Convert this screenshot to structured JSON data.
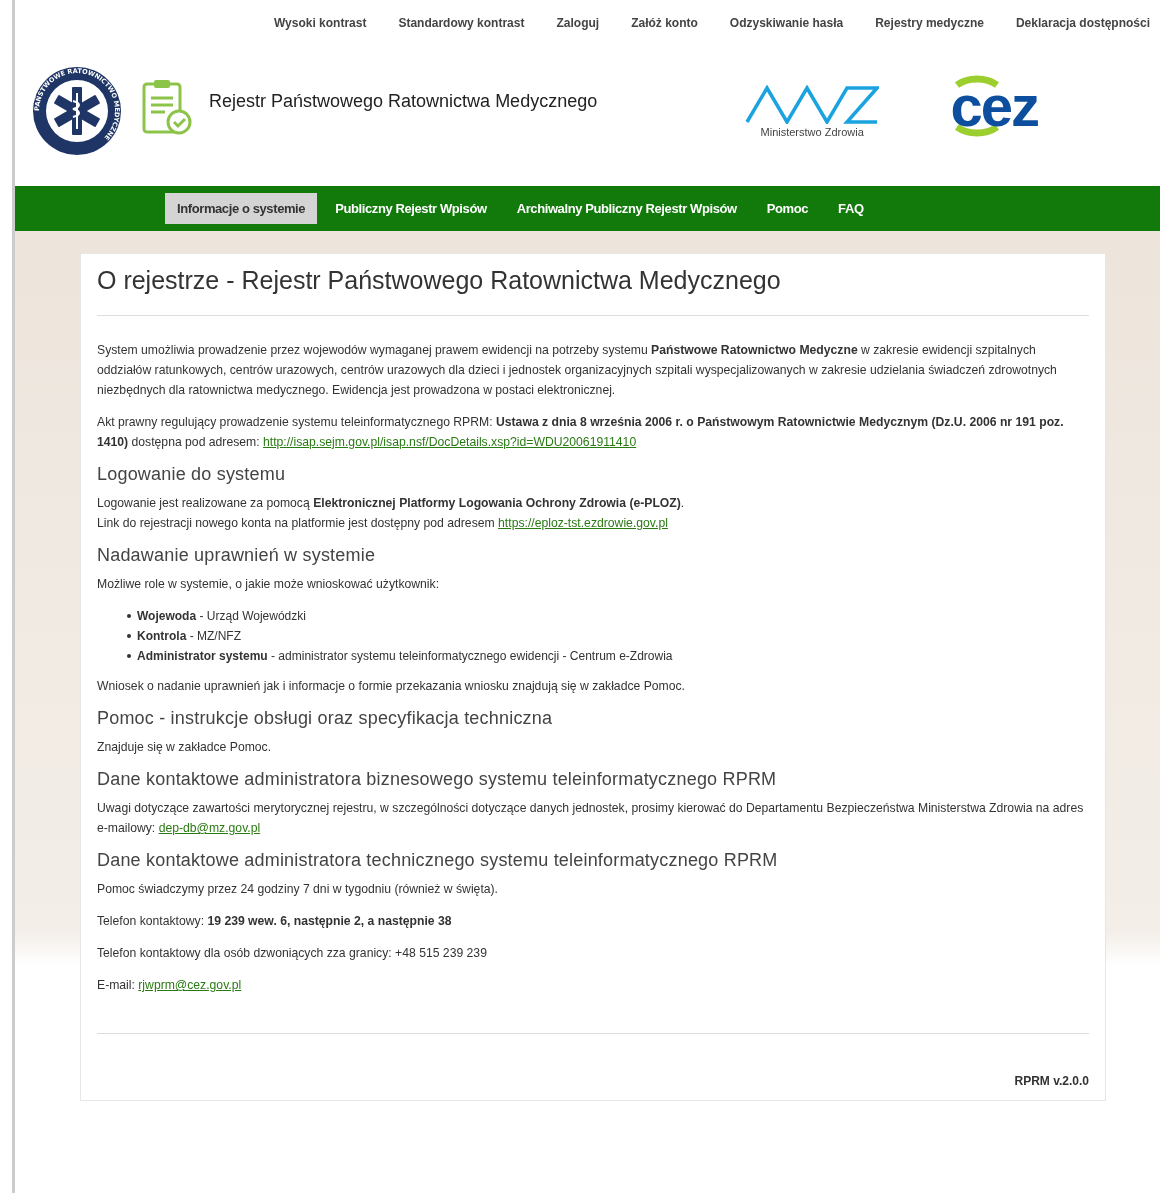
{
  "top_links": [
    "Wysoki kontrast",
    "Standardowy kontrast",
    "Zaloguj",
    "Załóż konto",
    "Odzyskiwanie hasła",
    "Rejestry medyczne",
    "Deklaracja dostępności"
  ],
  "header": {
    "emblem_text": "PAŃSTWOWE RATOWNICTWO MEDYCZNE",
    "title": "Rejestr Państwowego Ratownictwa Medycznego",
    "mz_caption": "Ministerstwo Zdrowia",
    "cez_logo": "cez"
  },
  "nav": [
    {
      "label": "Informacje o systemie",
      "selected": true
    },
    {
      "label": "Publiczny Rejestr Wpisów",
      "selected": false
    },
    {
      "label": "Archiwalny Publiczny Rejestr Wpisów",
      "selected": false
    },
    {
      "label": "Pomoc",
      "selected": false
    },
    {
      "label": "FAQ",
      "selected": false
    }
  ],
  "page_title": "O rejestrze - Rejestr Państwowego Ratownictwa Medycznego",
  "blocks": [
    {
      "kind": "p",
      "lines": [
        "System umożliwia prowadzenie przez wojewodów wymaganej prawem ewidencji na potrzeby systemu **Państwowe Ratownictwo Medyczne** w zakresie ewidencji szpitalnych oddziałów ratunkowych, centrów urazowych, centrów urazowych dla dzieci i jednostek organizacyjnych szpitali wyspecjalizowanych w zakresie udzielania świadczeń zdrowotnych niezbędnych dla ratownictwa medycznego. Ewidencja jest prowadzona w postaci elektronicznej."
      ]
    },
    {
      "kind": "p",
      "lines": [
        "Akt prawny regulujący prowadzenie systemu teleinformatycznego RPRM: **Ustawa z dnia 8 września 2006 r. o Państwowym Ratownictwie Medycznym (Dz.U. 2006 nr 191 poz. 1410)** dostępna pod adresem: "
      ],
      "link": "http://isap.sejm.gov.pl/isap.nsf/DocDetails.xsp?id=WDU20061911410"
    },
    {
      "kind": "h",
      "text": "Logowanie do systemu"
    },
    {
      "kind": "p",
      "lines": [
        "Logowanie jest realizowane za pomocą **Elektronicznej Platformy Logowania Ochrony Zdrowia (e-PLOZ)**.",
        "Link do rejestracji nowego konta na platformie jest dostępny pod adresem "
      ],
      "link": "https://eploz-tst.ezdrowie.gov.pl"
    },
    {
      "kind": "h",
      "text": "Nadawanie uprawnień w systemie"
    },
    {
      "kind": "p",
      "lines": [
        "Możliwe role w systemie, o jakie może wnioskować użytkownik:"
      ]
    },
    {
      "kind": "list",
      "items": [
        "**Wojewoda** - Urząd Wojewódzki",
        "**Kontrola** - MZ/NFZ",
        "**Administrator systemu** - administrator systemu teleinformatycznego ewidencji - Centrum e-Zdrowia"
      ]
    },
    {
      "kind": "p",
      "lines": [
        "Wniosek o nadanie uprawnień jak i informacje o formie przekazania wniosku znajdują się w zakładce Pomoc."
      ]
    },
    {
      "kind": "h",
      "text": "Pomoc - instrukcje obsługi oraz specyfikacja techniczna"
    },
    {
      "kind": "p",
      "lines": [
        "Znajduje się w zakładce Pomoc."
      ]
    },
    {
      "kind": "h",
      "text": "Dane kontaktowe administratora biznesowego systemu teleinformatycznego RPRM"
    },
    {
      "kind": "p",
      "lines": [
        "Uwagi dotyczące zawartości merytorycznej rejestru, w szczególności dotyczące danych jednostek, prosimy kierować do Departamentu Bezpieczeństwa Ministerstwa Zdrowia na adres e-mailowy: "
      ],
      "link": "dep-db@mz.gov.pl"
    },
    {
      "kind": "h",
      "text": "Dane kontaktowe administratora technicznego systemu teleinformatycznego RPRM"
    },
    {
      "kind": "p",
      "lines": [
        "Pomoc świadczymy przez 24 godziny 7 dni w tygodniu (również w święta)."
      ]
    },
    {
      "kind": "p",
      "lines": [
        "Telefon kontaktowy: **19 239 wew. 6, następnie 2, a następnie 38**"
      ]
    },
    {
      "kind": "p",
      "lines": [
        "Telefon kontaktowy dla osób dzwoniących zza granicy: +48 515 239 239"
      ]
    },
    {
      "kind": "p",
      "lines": [
        "E-mail: "
      ],
      "link": "rjwprm@cez.gov.pl"
    }
  ],
  "version": "RPRM v.2.0.0"
}
